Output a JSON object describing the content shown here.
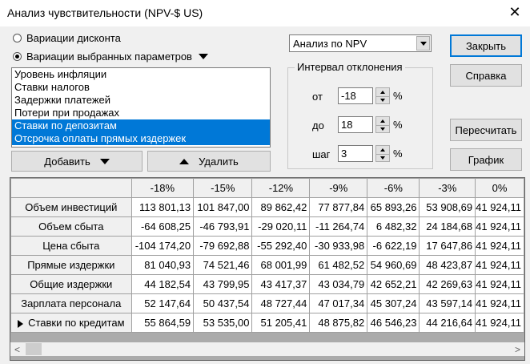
{
  "window": {
    "title": "Анализ чувствительности (NPV-$ US)",
    "close_glyph": "✕"
  },
  "mode": {
    "options": [
      {
        "label": "Вариации дисконта",
        "checked": false
      },
      {
        "label": "Вариации выбранных параметров",
        "checked": true
      }
    ]
  },
  "params_list": {
    "items": [
      {
        "label": "Уровень инфляции",
        "selected": false
      },
      {
        "label": "Ставки налогов",
        "selected": false
      },
      {
        "label": "Задержки платежей",
        "selected": false
      },
      {
        "label": "Потери при продажах",
        "selected": false
      },
      {
        "label": "Ставки по депозитам",
        "selected": true
      },
      {
        "label": "Отсрочка оплаты прямых издержек",
        "selected": true
      }
    ]
  },
  "buttons": {
    "add": "Добавить",
    "remove": "Удалить",
    "close": "Закрыть",
    "help": "Справка",
    "recalc": "Пересчитать",
    "graph": "График"
  },
  "analysis_combo": {
    "value": "Анализ по NPV"
  },
  "interval": {
    "legend": "Интервал отклонения",
    "from_label": "от",
    "from_value": "-18",
    "to_label": "до",
    "to_value": "18",
    "step_label": "шаг",
    "step_value": "3",
    "unit": "%"
  },
  "table": {
    "columns": [
      "-18%",
      "-15%",
      "-12%",
      "-9%",
      "-6%",
      "-3%",
      "0%"
    ],
    "rows": [
      {
        "label": "Объем инвестиций",
        "values": [
          "113 801,13",
          "101 847,00",
          "89 862,42",
          "77 877,84",
          "65 893,26",
          "53 908,69",
          "41 924,11"
        ]
      },
      {
        "label": "Объем сбыта",
        "values": [
          "-64 608,25",
          "-46 793,91",
          "-29 020,11",
          "-11 264,74",
          "6 482,32",
          "24 184,68",
          "41 924,11"
        ]
      },
      {
        "label": "Цена сбыта",
        "values": [
          "-104 174,20",
          "-79 692,88",
          "-55 292,40",
          "-30 933,98",
          "-6 622,19",
          "17 647,86",
          "41 924,11"
        ]
      },
      {
        "label": "Прямые издержки",
        "values": [
          "81 040,93",
          "74 521,46",
          "68 001,99",
          "61 482,52",
          "54 960,69",
          "48 423,87",
          "41 924,11"
        ]
      },
      {
        "label": "Общие издержки",
        "values": [
          "44 182,54",
          "43 799,95",
          "43 417,37",
          "43 034,79",
          "42 652,21",
          "42 269,63",
          "41 924,11"
        ]
      },
      {
        "label": "Зарплата персонала",
        "values": [
          "52 147,64",
          "50 437,54",
          "48 727,44",
          "47 017,34",
          "45 307,24",
          "43 597,14",
          "41 924,11"
        ]
      },
      {
        "label": "Ставки по кредитам",
        "values": [
          "55 864,59",
          "53 535,00",
          "51 205,41",
          "48 875,82",
          "46 546,23",
          "44 216,64",
          "41 924,11"
        ],
        "current": true
      }
    ]
  },
  "scrollbar": {
    "left_glyph": "<",
    "right_glyph": ">"
  }
}
